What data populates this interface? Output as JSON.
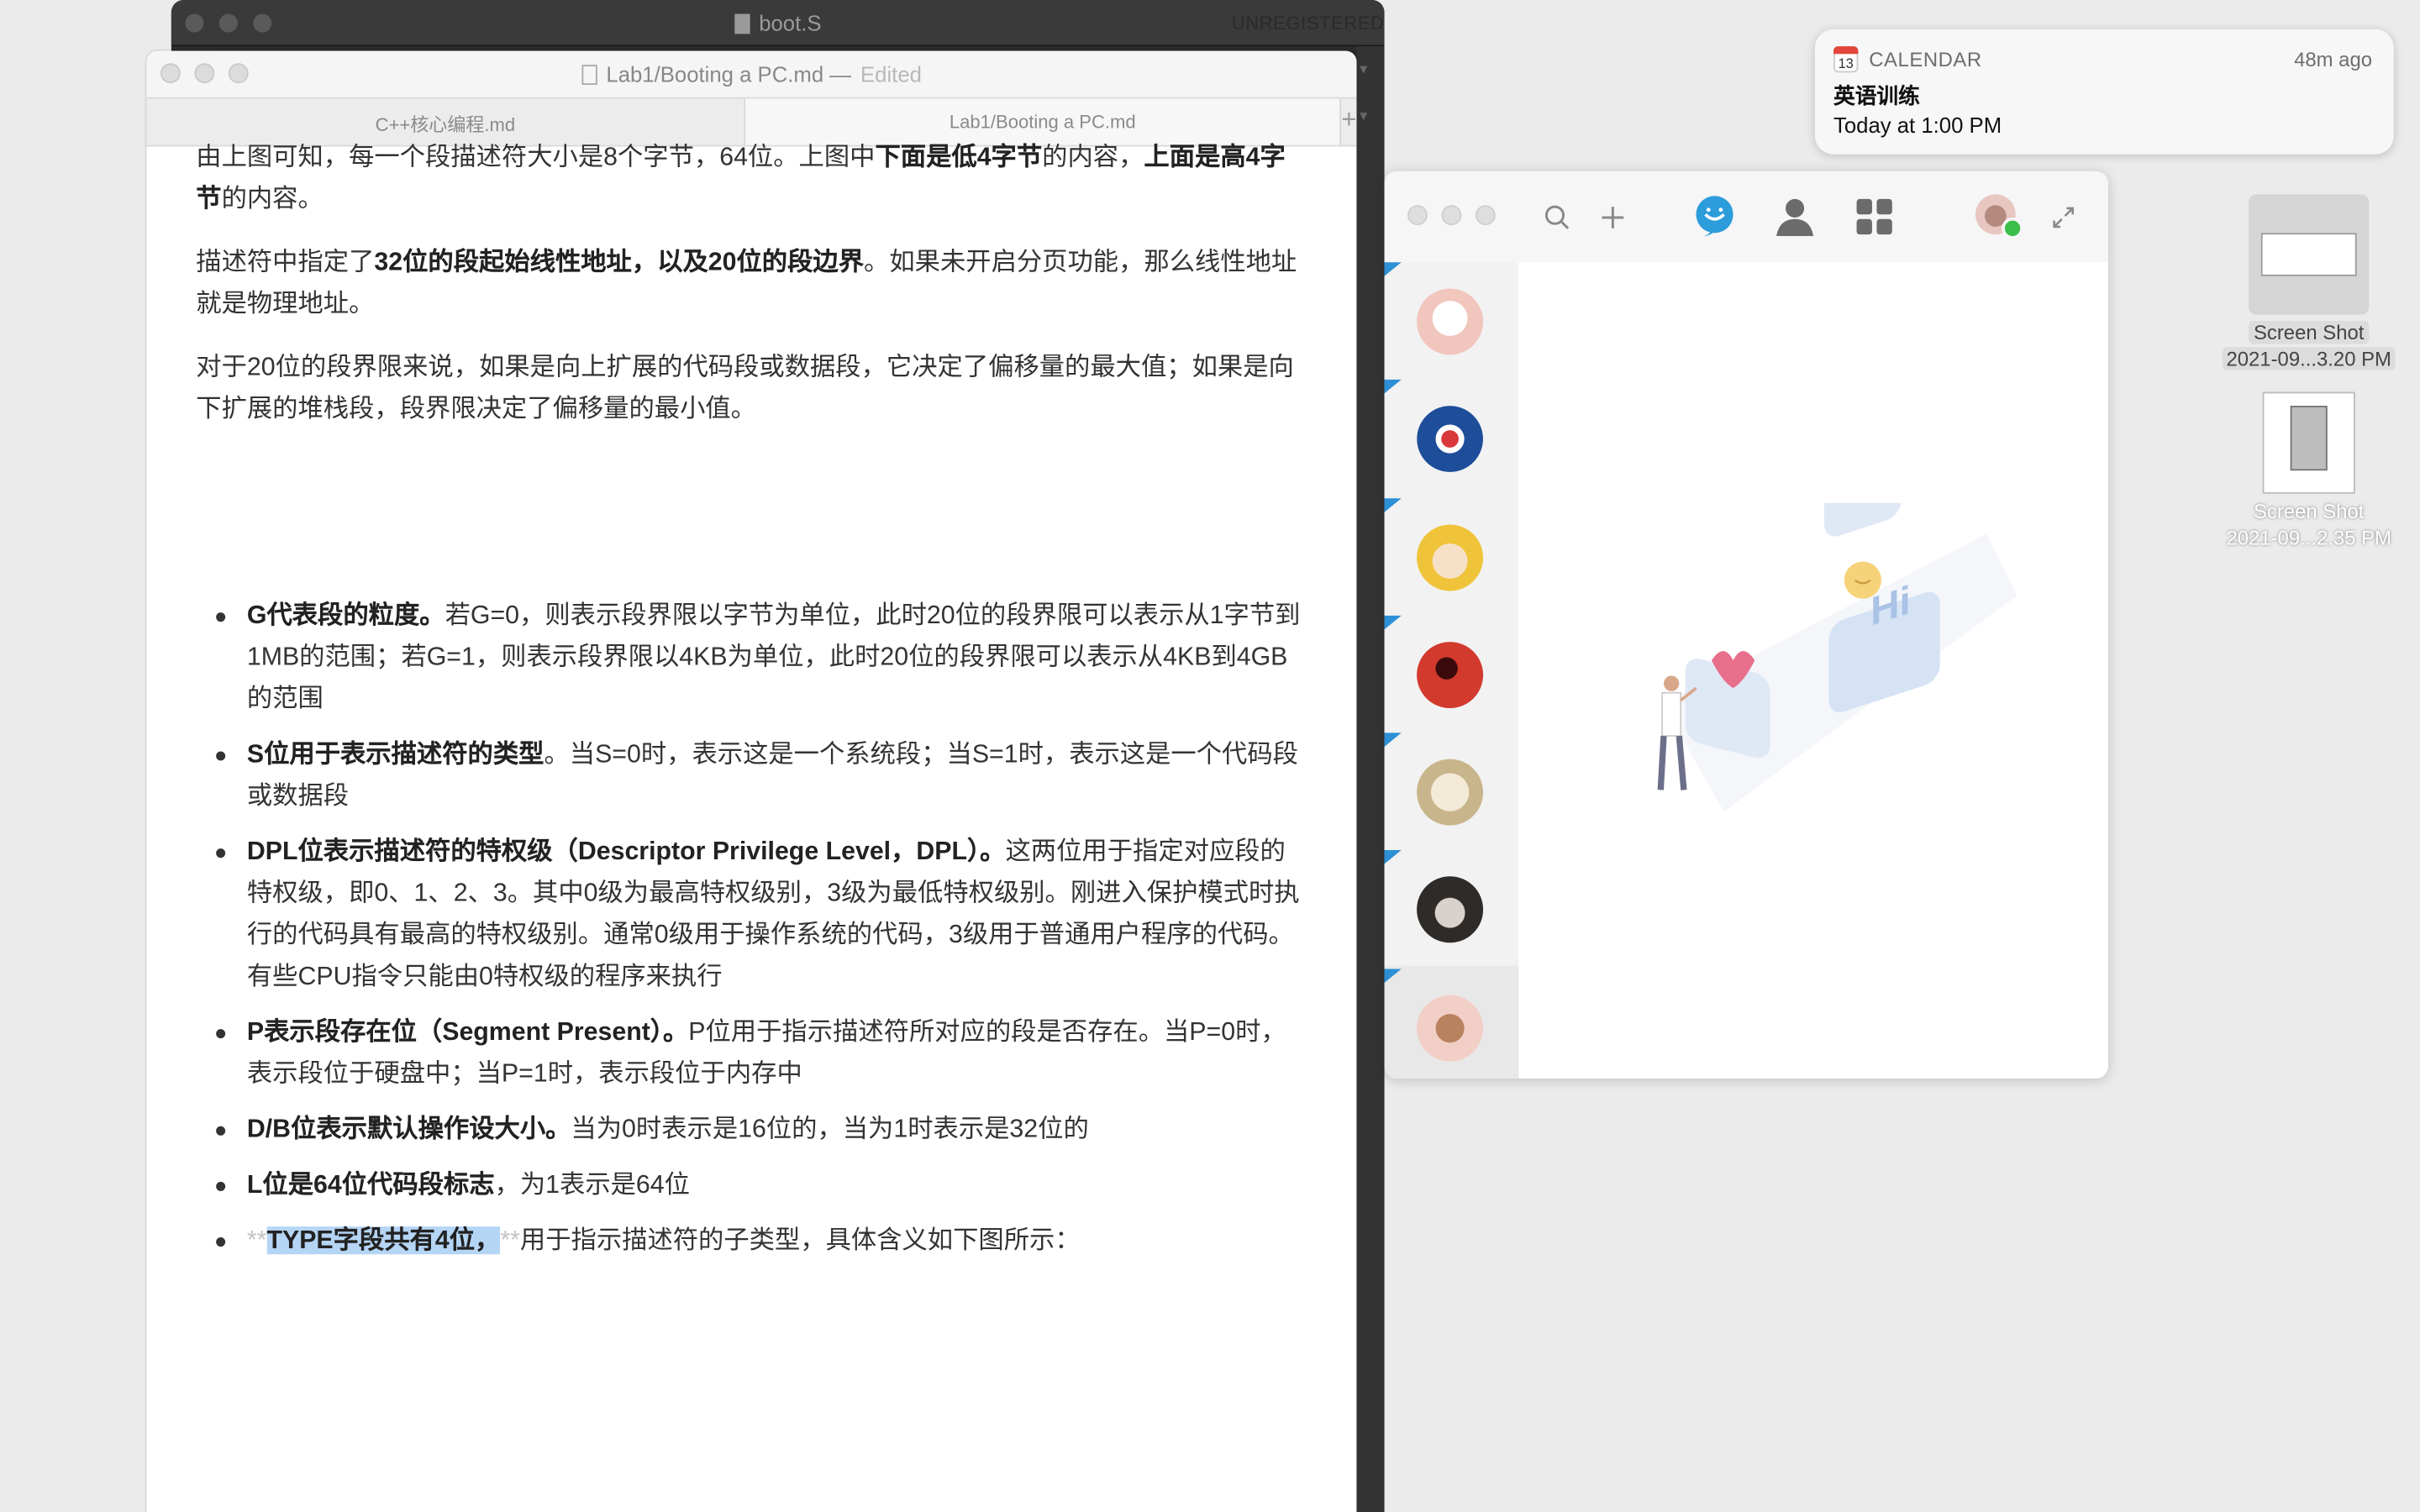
{
  "back_window": {
    "title": "boot.S",
    "unregistered": "UNREGISTERED"
  },
  "editor": {
    "title": "Lab1/Booting a PC.md",
    "title_sep": "—",
    "status": "Edited",
    "tabs": [
      {
        "label": "C++核心编程.md",
        "active": false
      },
      {
        "label": "Lab1/Booting a PC.md",
        "active": true
      }
    ],
    "add_tab": "+",
    "content": {
      "p1": {
        "a": "由上图可知，每一个段描述符大小是8个字节，64位。上图中",
        "b1": "下面是低4字节",
        "c": "的内容，",
        "b2": "上面是高4字节",
        "d": "的内容。"
      },
      "p2": {
        "a": "描述符中指定了",
        "b": "32位的段起始线性地址，以及20位的段边界",
        "c": "。如果未开启分页功能，那么线性地址就是物理地址。"
      },
      "p3": "对于20位的段界限来说，如果是向上扩展的代码段或数据段，它决定了偏移量的最大值；如果是向下扩展的堆栈段，段界限决定了偏移量的最小值。",
      "bullets": [
        {
          "bold": "G代表段的粒度。",
          "rest": "若G=0，则表示段界限以字节为单位，此时20位的段界限可以表示从1字节到1MB的范围；若G=1，则表示段界限以4KB为单位，此时20位的段界限可以表示从4KB到4GB的范围"
        },
        {
          "bold": "S位用于表示描述符的类型",
          "rest": "。当S=0时，表示这是一个系统段；当S=1时，表示这是一个代码段或数据段"
        },
        {
          "bold": "DPL位表示描述符的特权级（Descriptor Privilege Level，DPL）。",
          "rest": "这两位用于指定对应段的特权级，即0、1、2、3。其中0级为最高特权级别，3级为最低特权级别。刚进入保护模式时执行的代码具有最高的特权级别。通常0级用于操作系统的代码，3级用于普通用户程序的代码。有些CPU指令只能由0特权级的程序来执行"
        },
        {
          "bold": "P表示段存在位（Segment Present）。",
          "rest": "P位用于指示描述符所对应的段是否存在。当P=0时，表示段位于硬盘中；当P=1时，表示段位于内存中"
        },
        {
          "bold": "D/B位表示默认操作设大小。",
          "rest": "当为0时表示是16位的，当为1时表示是32位的"
        },
        {
          "bold": "L位是64位代码段标志",
          "rest": "，为1表示是64位"
        }
      ],
      "last_bullet": {
        "stars_open": "**",
        "highlight": "TYPE字段共有4位，",
        "stars_close": "**",
        "rest": "用于指示描述符的子类型，具体含义如下图所示："
      }
    }
  },
  "notification": {
    "app": "CALENDAR",
    "icon_day": "13",
    "time": "48m ago",
    "title": "英语训练",
    "subtitle": "Today at 1:00 PM"
  },
  "desktop": {
    "items": [
      {
        "line1": "Screen Shot",
        "line2": "2021-09...3.20 PM"
      },
      {
        "line1": "Screen Shot",
        "line2": "2021-09...2.35 PM"
      }
    ]
  },
  "qq": {
    "bubble_text": "Hi",
    "colors": {
      "accent": "#2d8fd6",
      "online": "#3bbf4a"
    }
  }
}
